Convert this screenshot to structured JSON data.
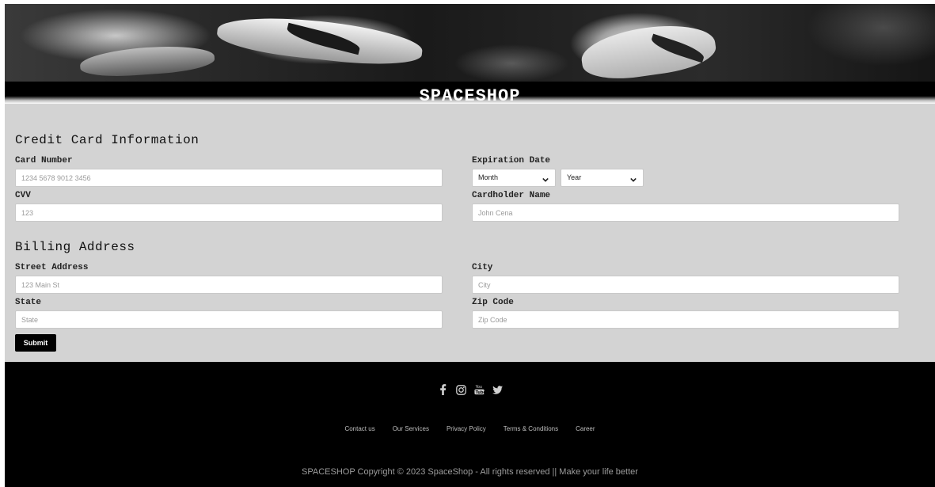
{
  "header": {
    "brand": "SPACESHOP"
  },
  "credit_card": {
    "title": "Credit Card Information",
    "card_number_label": "Card Number",
    "card_number_placeholder": "1234 5678 9012 3456",
    "expiration_label": "Expiration Date",
    "month_selected": "Month",
    "year_selected": "Year",
    "cvv_label": "CVV",
    "cvv_placeholder": "123",
    "cardholder_label": "Cardholder Name",
    "cardholder_placeholder": "John Cena"
  },
  "billing": {
    "title": "Billing Address",
    "street_label": "Street Address",
    "street_placeholder": "123 Main St",
    "city_label": "City",
    "city_placeholder": "City",
    "state_label": "State",
    "state_placeholder": "State",
    "zip_label": "Zip Code",
    "zip_placeholder": "Zip Code"
  },
  "submit_label": "Submit",
  "footer": {
    "social_icons": [
      "facebook-icon",
      "instagram-icon",
      "youtube-icon",
      "twitter-icon"
    ],
    "links": [
      "Contact us",
      "Our Services",
      "Privacy Policy",
      "Terms & Conditions",
      "Career"
    ],
    "copyright": "SPACESHOP Copyright © 2023 SpaceShop - All rights reserved || Make your life better"
  },
  "colors": {
    "form_background": "#d3d3d3",
    "footer_background": "#000000",
    "button_background": "#000000"
  }
}
